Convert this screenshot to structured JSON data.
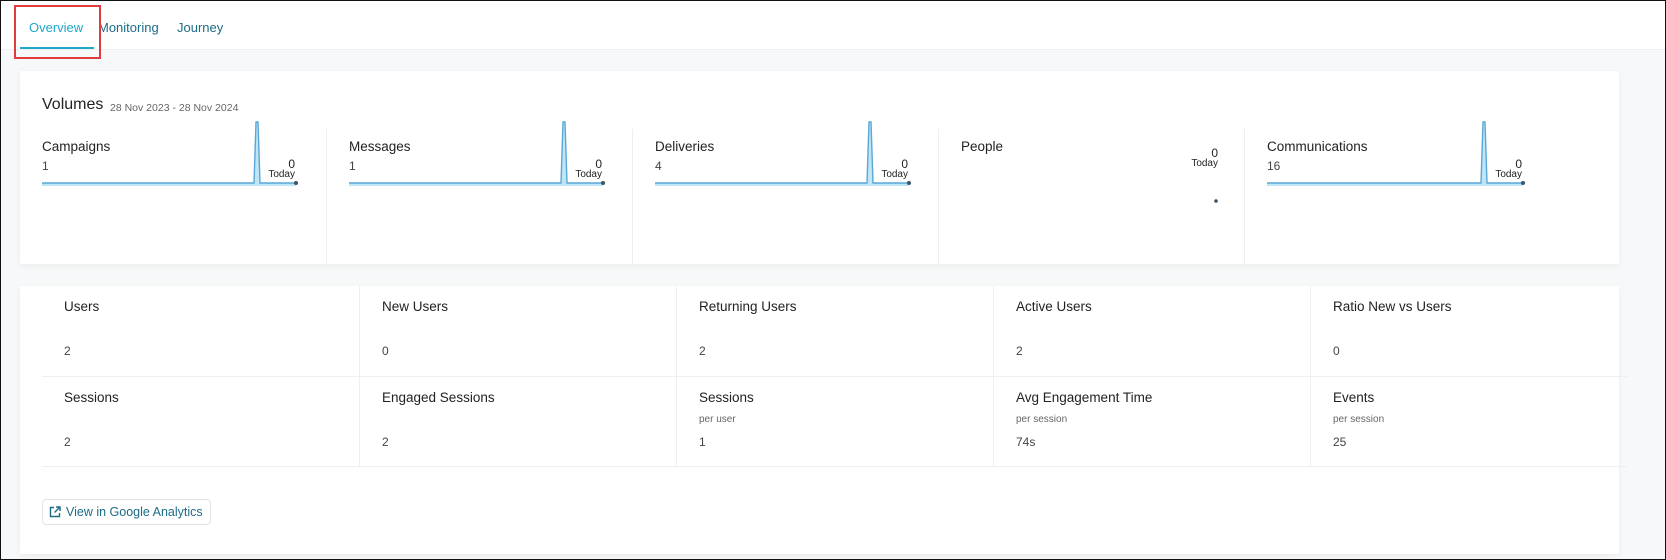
{
  "tabs": [
    {
      "label": "Overview",
      "active": true
    },
    {
      "label": "Monitoring",
      "active": false
    },
    {
      "label": "Journey",
      "active": false
    }
  ],
  "volumes": {
    "title": "Volumes",
    "date_range": "28 Nov 2023 - 28 Nov 2024",
    "today_label": "Today",
    "cells": [
      {
        "label": "Campaigns",
        "count": "1",
        "today_value": "0",
        "has_chart": true
      },
      {
        "label": "Messages",
        "count": "1",
        "today_value": "0",
        "has_chart": true
      },
      {
        "label": "Deliveries",
        "count": "4",
        "today_value": "0",
        "has_chart": true
      },
      {
        "label": "People",
        "count": "",
        "today_value": "0",
        "has_chart": false
      },
      {
        "label": "Communications",
        "count": "16",
        "today_value": "0",
        "has_chart": true
      }
    ]
  },
  "analytics": {
    "rows": [
      [
        {
          "label": "Users",
          "sub": "",
          "value": "2"
        },
        {
          "label": "New Users",
          "sub": "",
          "value": "0"
        },
        {
          "label": "Returning Users",
          "sub": "",
          "value": "2"
        },
        {
          "label": "Active Users",
          "sub": "",
          "value": "2"
        },
        {
          "label": "Ratio New vs Users",
          "sub": "",
          "value": "0"
        }
      ],
      [
        {
          "label": "Sessions",
          "sub": "",
          "value": "2"
        },
        {
          "label": "Engaged Sessions",
          "sub": "",
          "value": "2"
        },
        {
          "label": "Sessions",
          "sub": "per user",
          "value": "1"
        },
        {
          "label": "Avg Engagement Time",
          "sub": "per session",
          "value": "74s"
        },
        {
          "label": "Events",
          "sub": "per session",
          "value": "25"
        }
      ]
    ],
    "ga_button_label": "View in Google Analytics"
  },
  "colors": {
    "accent": "#22a6c9",
    "link": "#1d6b86",
    "spark_line": "#5aa7d6",
    "spark_fill": "#bfe6f6",
    "highlight": "#e23b3b"
  },
  "icons": {
    "ga_button": "external-link-icon"
  }
}
